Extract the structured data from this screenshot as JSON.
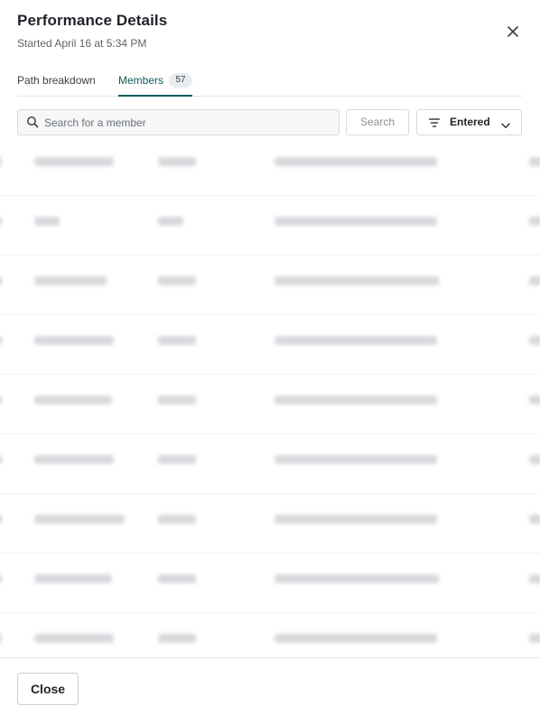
{
  "dialog": {
    "title": "Performance Details",
    "subtitle": "Started April 16 at 5:34 PM"
  },
  "tabs": [
    {
      "label": "Path breakdown"
    },
    {
      "label": "Members",
      "count": "57",
      "active": true
    }
  ],
  "search": {
    "placeholder": "Search for a member",
    "value": "",
    "button_label": "Search"
  },
  "filter": {
    "label": "Entered"
  },
  "table": {
    "row_count_visible": 9,
    "content_obscured": true
  },
  "footer": {
    "close_label": "Close"
  },
  "colors": {
    "accent": "#0f5c5a",
    "border": "#d7dadd",
    "muted_text": "#5f6368"
  },
  "icons": [
    "close-icon",
    "search-icon",
    "filter-icon",
    "chevron-down-icon"
  ]
}
